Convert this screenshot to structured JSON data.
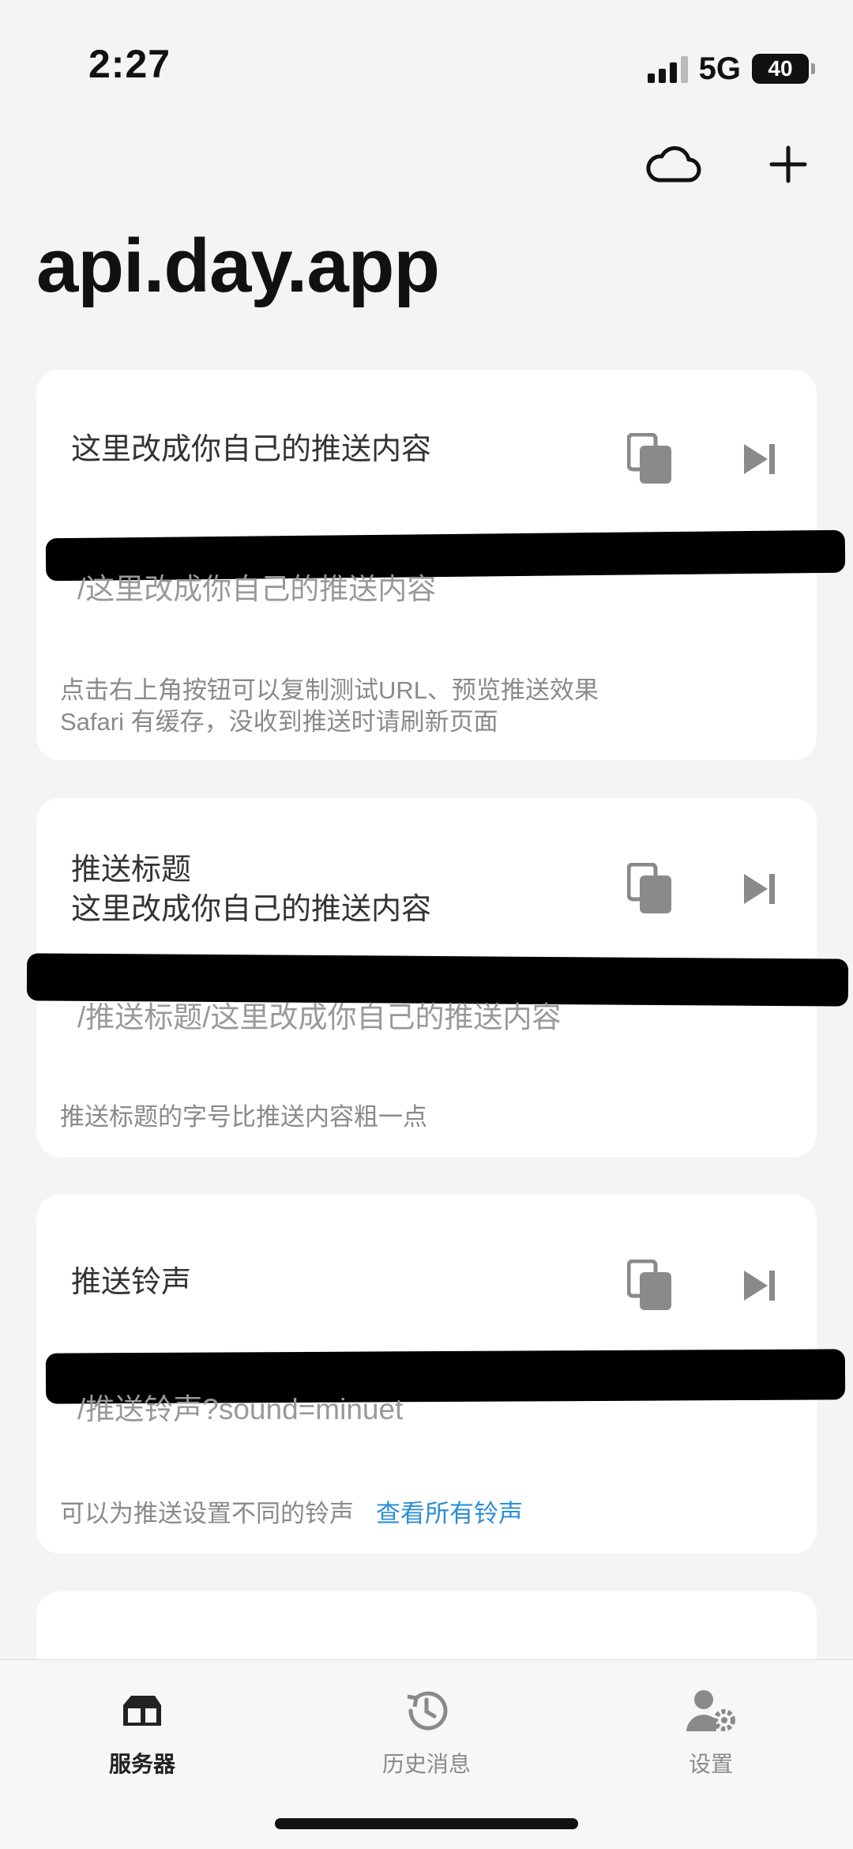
{
  "status_bar": {
    "time": "2:27",
    "network": "5G",
    "battery": "40"
  },
  "header": {
    "title": "api.day.app"
  },
  "nav_icons": [
    "cloud-icon",
    "plus-icon"
  ],
  "cards": [
    {
      "heading": "这里改成你自己的推送内容",
      "url_visible": "/这里改成你自己的推送内容",
      "note_lines": [
        "点击右上角按钮可以复制测试URL、预览推送效果",
        "Safari 有缓存，没收到推送时请刷新页面"
      ]
    },
    {
      "heading": "推送标题\n这里改成你自己的推送内容",
      "url_visible": "/推送标题/这里改成你自己的推送内容",
      "note_lines": [
        "推送标题的字号比推送内容粗一点"
      ]
    },
    {
      "heading": "推送铃声",
      "url_visible": "/推送铃声?sound=minuet",
      "note_lines": [
        "可以为推送设置不同的铃声"
      ],
      "note_link": "查看所有铃声"
    }
  ],
  "tabs": [
    {
      "label": "服务器",
      "icon": "server-icon",
      "active": true
    },
    {
      "label": "历史消息",
      "icon": "history-icon",
      "active": false
    },
    {
      "label": "设置",
      "icon": "settings-icon",
      "active": false
    }
  ],
  "colors": {
    "link": "#2b8fd6",
    "active_tab": "#222222",
    "inactive_tab": "#8a8a8a"
  }
}
